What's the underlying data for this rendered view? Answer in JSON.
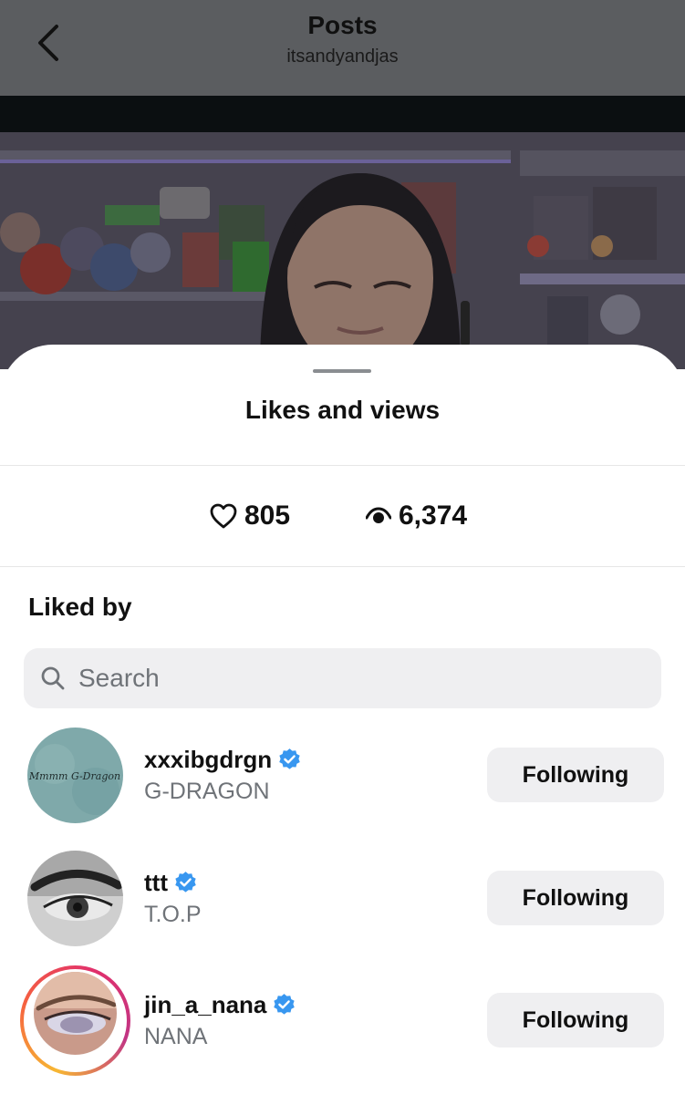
{
  "header": {
    "title": "Posts",
    "subtitle": "itsandyandjas",
    "back_icon": "chevron-left-icon"
  },
  "sheet": {
    "title": "Likes and views",
    "stats": {
      "likes_count": "805",
      "views_count": "6,374",
      "likes_icon": "heart-outline-icon",
      "views_icon": "eye-icon"
    },
    "liked_by_label": "Liked by",
    "search": {
      "placeholder": "Search",
      "icon": "search-icon"
    },
    "users": [
      {
        "username": "xxxibgdrgn",
        "full_name": "G-DRAGON",
        "verified": true,
        "button_label": "Following",
        "avatar_text": "Mmmm G-Dragon"
      },
      {
        "username": "ttt",
        "full_name": "T.O.P",
        "verified": true,
        "button_label": "Following"
      },
      {
        "username": "jin_a_nana",
        "full_name": "NANA",
        "verified": true,
        "button_label": "Following",
        "has_story_ring": true
      }
    ]
  },
  "colors": {
    "verified_blue": "#3897f0",
    "button_bg": "#efeff1",
    "header_dim": "#5b5d60",
    "secondary_text": "#6f7378"
  }
}
